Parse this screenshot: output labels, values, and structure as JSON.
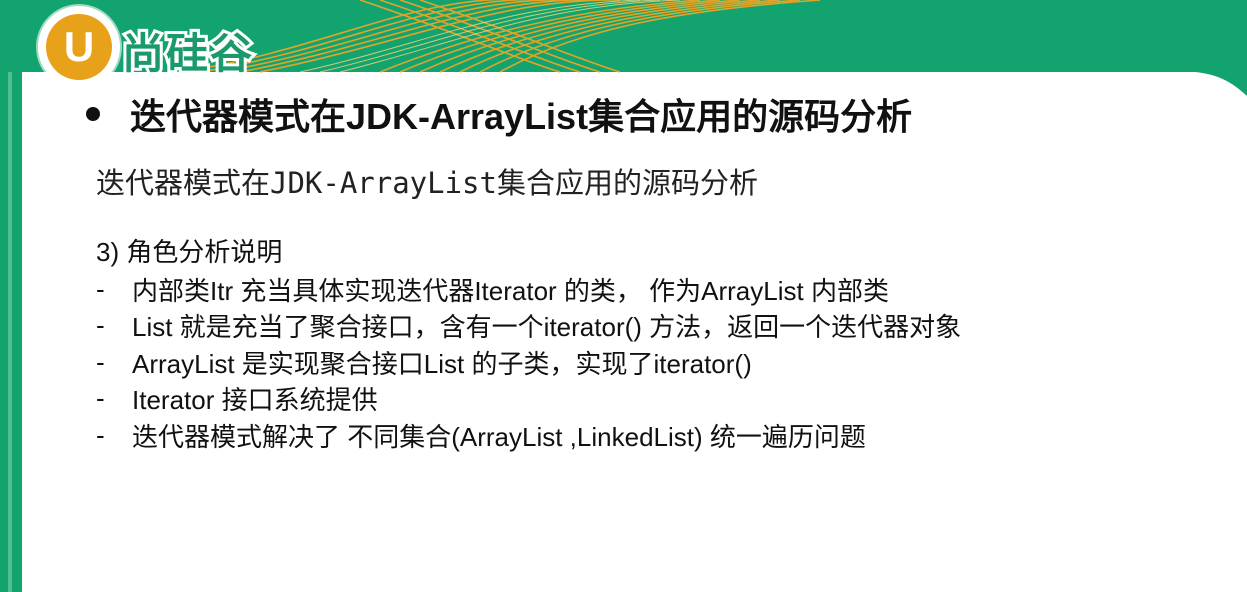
{
  "logo": {
    "mark": "U",
    "text": "尚硅谷"
  },
  "colors": {
    "accent_green": "#13a36f",
    "accent_orange": "#f0a11e",
    "logo_orange": "#e8a21a"
  },
  "slide": {
    "title": "迭代器模式在JDK-ArrayList集合应用的源码分析",
    "subtitle": "迭代器模式在JDK-ArrayList集合应用的源码分析",
    "section_heading": "3)  角色分析说明",
    "points": [
      {
        "marker": "-",
        "text": "内部类Itr 充当具体实现迭代器Iterator 的类， 作为ArrayList 内部类"
      },
      {
        "marker": "-",
        "text": "List 就是充当了聚合接口，含有一个iterator() 方法，返回一个迭代器对象"
      },
      {
        "marker": "-",
        "text": "ArrayList 是实现聚合接口List 的子类，实现了iterator()"
      },
      {
        "marker": "-",
        "text": "Iterator 接口系统提供"
      },
      {
        "marker": "-",
        "text": "迭代器模式解决了 不同集合(ArrayList ,LinkedList) 统一遍历问题"
      }
    ]
  }
}
